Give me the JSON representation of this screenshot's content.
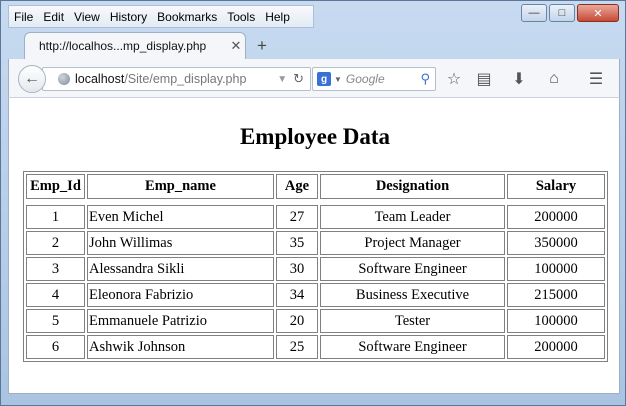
{
  "menu": [
    "File",
    "Edit",
    "View",
    "History",
    "Bookmarks",
    "Tools",
    "Help"
  ],
  "tab": {
    "title": "http://localhos...mp_display.php"
  },
  "url": {
    "host": "localhost",
    "path": "/Site/emp_display.php"
  },
  "search": {
    "placeholder": "Google"
  },
  "page": {
    "heading": "Employee Data",
    "columns": [
      "Emp_Id",
      "Emp_name",
      "Age",
      "Designation",
      "Salary"
    ],
    "rows": [
      [
        "1",
        "Even Michel",
        "27",
        "Team Leader",
        "200000"
      ],
      [
        "2",
        "John Willimas",
        "35",
        "Project Manager",
        "350000"
      ],
      [
        "3",
        "Alessandra Sikli",
        "30",
        "Software Engineer",
        "100000"
      ],
      [
        "4",
        "Eleonora Fabrizio",
        "34",
        "Business Executive",
        "215000"
      ],
      [
        "5",
        "Emmanuele Patrizio",
        "20",
        "Tester",
        "100000"
      ],
      [
        "6",
        "Ashwik Johnson",
        "25",
        "Software Engineer",
        "200000"
      ]
    ]
  }
}
